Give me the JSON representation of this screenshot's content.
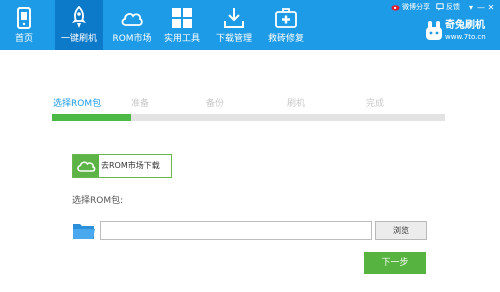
{
  "nav": [
    {
      "label": "首页",
      "icon": "phone-icon"
    },
    {
      "label": "一键刷机",
      "icon": "rocket-icon",
      "active": true
    },
    {
      "label": "ROM市场",
      "icon": "cloud-icon"
    },
    {
      "label": "实用工具",
      "icon": "grid-icon"
    },
    {
      "label": "下载管理",
      "icon": "download-icon"
    },
    {
      "label": "救砖修复",
      "icon": "medkit-icon"
    }
  ],
  "top_links": {
    "weibo": "微博分享",
    "feedback": "反馈"
  },
  "window_controls": {
    "menu": "▾",
    "minimize": "—",
    "close": "✕"
  },
  "brand": {
    "title": "奇兔刷机",
    "url": "www.7to.cn"
  },
  "steps": [
    {
      "label": "选择ROM包",
      "current": true
    },
    {
      "label": "准备"
    },
    {
      "label": "备份"
    },
    {
      "label": "刷机"
    },
    {
      "label": "完成"
    }
  ],
  "progress": {
    "fraction": 0.2
  },
  "rom_market_button": "去ROM市场下载",
  "select_label": "选择ROM包:",
  "rom_path": {
    "value": "",
    "placeholder": ""
  },
  "browse_button": "浏览",
  "next_button": "下一步",
  "colors": {
    "topbar": "#1e9be6",
    "active_nav": "#0d79c9",
    "accent_green": "#56b33f",
    "progress_fill": "#4cb846",
    "step_current": "#1e9be6"
  }
}
